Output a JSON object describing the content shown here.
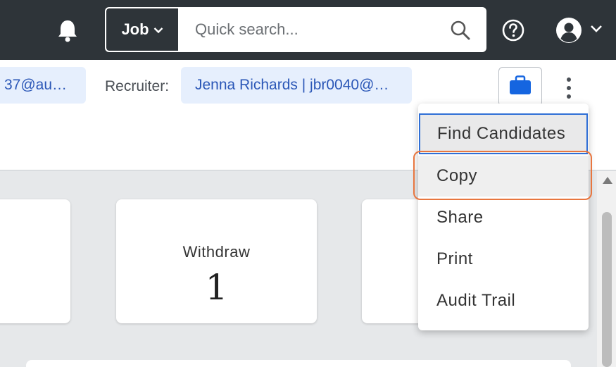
{
  "topbar": {
    "scope_label": "Job",
    "search_placeholder": "Quick search...",
    "icons": [
      "bell-icon",
      "chevron-down-icon",
      "search-icon",
      "help-icon",
      "user-avatar-icon"
    ]
  },
  "subheader": {
    "email_chip": "37@au…",
    "recruiter_label": "Recruiter:",
    "recruiter_value": "Jenna Richards | jbr0040@…",
    "briefcase_color": "#1565e0"
  },
  "cards": [
    {
      "title": "Withdraw",
      "value": "1"
    }
  ],
  "menu": {
    "items": [
      {
        "label": "Find Candidates"
      },
      {
        "label": "Copy"
      },
      {
        "label": "Share"
      },
      {
        "label": "Print"
      },
      {
        "label": "Audit Trail"
      }
    ],
    "highlight_color": "#e8763f",
    "focus_color": "#2f6fd6"
  }
}
